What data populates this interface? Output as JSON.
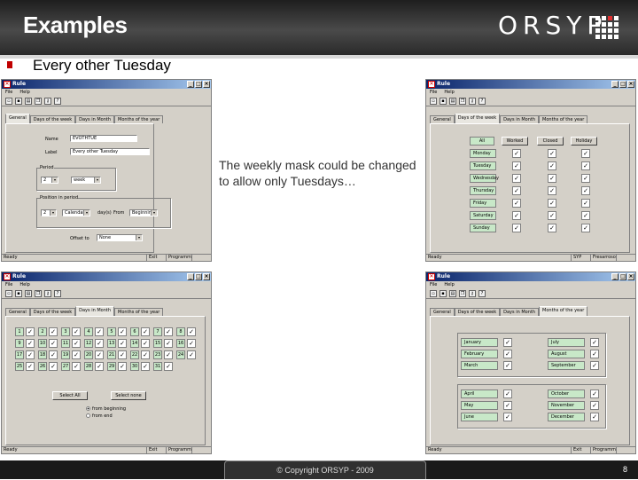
{
  "slide": {
    "title": "Examples",
    "logo": "ORSYP",
    "subtitle": "Every other Tuesday",
    "note": "The weekly mask could be changed to allow only Tuesdays…",
    "copyright": "© Copyright ORSYP - 2009",
    "page": "8"
  },
  "window": {
    "title": "Rule",
    "menu": [
      "File",
      "Help"
    ],
    "tabs": [
      "General",
      "Days of the week",
      "Days in Month",
      "Months of the year"
    ],
    "status_ready": "Ready",
    "status_exit": "Exit",
    "status_prog": "Programm"
  },
  "status_alt": {
    "exit": "SYP",
    "prog": "Fresarroso"
  },
  "general": {
    "name_label": "Name",
    "name_value": "EVOTHTUE",
    "label_label": "Label",
    "label_value": "Every other Tuesday",
    "period_title": "Period",
    "period_num": "2",
    "period_unit": "week",
    "position_title": "Position in period",
    "pos_num": "2",
    "pos_unit": "Calendar",
    "pos_days_label": "day(s)",
    "pos_from_label": "From",
    "pos_from": "Beginning",
    "offset_label": "Offset to",
    "offset_value": "None"
  },
  "week": {
    "headers": [
      "All",
      "Worked",
      "Closed",
      "Holiday"
    ],
    "days": [
      "Monday",
      "Tuesday",
      "Wednesday",
      "Thursday",
      "Friday",
      "Saturday",
      "Sunday"
    ]
  },
  "month": {
    "days": [
      "1",
      "2",
      "3",
      "4",
      "5",
      "6",
      "7",
      "8",
      "9",
      "10",
      "11",
      "12",
      "13",
      "14",
      "15",
      "16",
      "17",
      "18",
      "19",
      "20",
      "21",
      "22",
      "23",
      "24",
      "25",
      "26",
      "27",
      "28",
      "29",
      "30",
      "31"
    ],
    "select_all": "Select All",
    "select_none": "Select none",
    "from_beginning": "from beginning",
    "from_end": "from end"
  },
  "year": {
    "months_left": [
      "January",
      "February",
      "March",
      "April",
      "May",
      "June"
    ],
    "months_right": [
      "July",
      "August",
      "September",
      "October",
      "November",
      "December"
    ]
  },
  "colors": {
    "accent_green": "#c8e8c8",
    "titlebar": "#0a246a",
    "brand_red": "#c00000"
  }
}
